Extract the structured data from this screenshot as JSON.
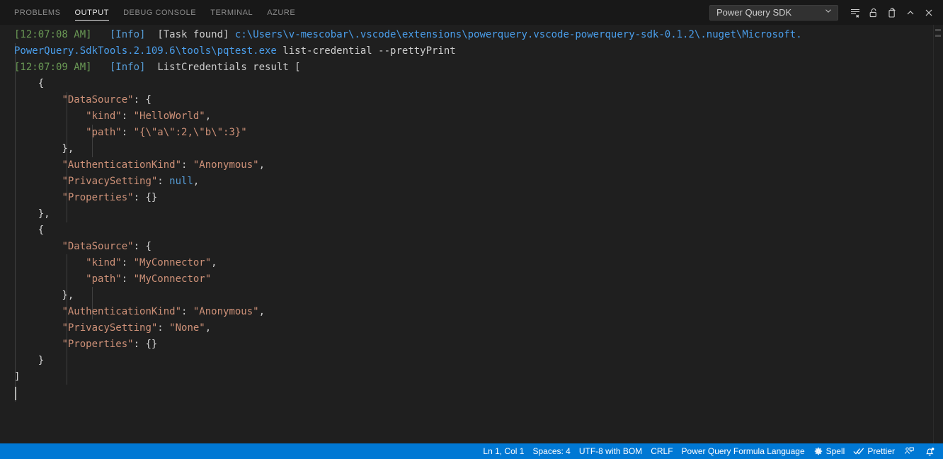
{
  "panel": {
    "tabs": [
      {
        "label": "PROBLEMS",
        "name": "tab-problems",
        "active": false
      },
      {
        "label": "OUTPUT",
        "name": "tab-output",
        "active": true
      },
      {
        "label": "DEBUG CONSOLE",
        "name": "tab-debug-console",
        "active": false
      },
      {
        "label": "TERMINAL",
        "name": "tab-terminal",
        "active": false
      },
      {
        "label": "AZURE",
        "name": "tab-azure",
        "active": false
      }
    ],
    "channel_select": {
      "value": "Power Query SDK",
      "icon": "chevron-down-icon"
    },
    "actions": [
      {
        "name": "clear-output-icon",
        "title": "Clear Output"
      },
      {
        "name": "unlock-scroll-icon",
        "title": "Turn Auto Scrolling Off"
      },
      {
        "name": "open-in-editor-icon",
        "title": "Open Output in Editor"
      },
      {
        "name": "chevron-up-icon",
        "title": "Hide Panel"
      },
      {
        "name": "close-icon",
        "title": "Close Panel"
      }
    ]
  },
  "output": {
    "lines": [
      {
        "tokens": [
          {
            "t": "[12:07:08 AM]",
            "c": "t-time"
          },
          {
            "t": "   ",
            "c": "t-plain"
          },
          {
            "t": "[Info]",
            "c": "t-info"
          },
          {
            "t": "  ",
            "c": "t-plain"
          },
          {
            "t": "[Task found]",
            "c": "t-plain"
          },
          {
            "t": " ",
            "c": "t-plain"
          },
          {
            "t": "c:\\Users\\v-mescobar\\.vscode\\extensions\\powerquery.vscode-powerquery-sdk-0.1.2\\.nuget\\Microsoft.",
            "c": "t-path"
          }
        ]
      },
      {
        "tokens": [
          {
            "t": "PowerQuery.SdkTools.2.109.6\\tools\\pqtest.exe",
            "c": "t-path"
          },
          {
            "t": " list-credential --prettyPrint",
            "c": "t-plain"
          }
        ]
      },
      {
        "tokens": [
          {
            "t": "[12:07:09 AM]",
            "c": "t-time"
          },
          {
            "t": "   ",
            "c": "t-plain"
          },
          {
            "t": "[Info]",
            "c": "t-info"
          },
          {
            "t": "  ",
            "c": "t-plain"
          },
          {
            "t": "ListCredentials result [",
            "c": "t-plain"
          }
        ]
      },
      {
        "tokens": [
          {
            "t": "    {",
            "c": "t-brace1"
          }
        ]
      },
      {
        "tokens": [
          {
            "t": "        ",
            "c": "t-plain"
          },
          {
            "t": "\"DataSource\"",
            "c": "t-key"
          },
          {
            "t": ": {",
            "c": "t-brace1"
          }
        ]
      },
      {
        "tokens": [
          {
            "t": "            ",
            "c": "t-plain"
          },
          {
            "t": "\"kind\"",
            "c": "t-key"
          },
          {
            "t": ": ",
            "c": "t-punct"
          },
          {
            "t": "\"HelloWorld\"",
            "c": "t-str"
          },
          {
            "t": ",",
            "c": "t-punct"
          }
        ]
      },
      {
        "tokens": [
          {
            "t": "            ",
            "c": "t-plain"
          },
          {
            "t": "\"path\"",
            "c": "t-key"
          },
          {
            "t": ": ",
            "c": "t-punct"
          },
          {
            "t": "\"{\\\"a\\\":2,\\\"b\\\":3}\"",
            "c": "t-str"
          }
        ]
      },
      {
        "tokens": [
          {
            "t": "        },",
            "c": "t-brace1"
          }
        ]
      },
      {
        "tokens": [
          {
            "t": "        ",
            "c": "t-plain"
          },
          {
            "t": "\"AuthenticationKind\"",
            "c": "t-key"
          },
          {
            "t": ": ",
            "c": "t-punct"
          },
          {
            "t": "\"Anonymous\"",
            "c": "t-str"
          },
          {
            "t": ",",
            "c": "t-punct"
          }
        ]
      },
      {
        "tokens": [
          {
            "t": "        ",
            "c": "t-plain"
          },
          {
            "t": "\"PrivacySetting\"",
            "c": "t-key"
          },
          {
            "t": ": ",
            "c": "t-punct"
          },
          {
            "t": "null",
            "c": "t-null"
          },
          {
            "t": ",",
            "c": "t-punct"
          }
        ]
      },
      {
        "tokens": [
          {
            "t": "        ",
            "c": "t-plain"
          },
          {
            "t": "\"Properties\"",
            "c": "t-key"
          },
          {
            "t": ": {}",
            "c": "t-brace1"
          }
        ]
      },
      {
        "tokens": [
          {
            "t": "    },",
            "c": "t-brace1"
          }
        ]
      },
      {
        "tokens": [
          {
            "t": "    {",
            "c": "t-brace1"
          }
        ]
      },
      {
        "tokens": [
          {
            "t": "        ",
            "c": "t-plain"
          },
          {
            "t": "\"DataSource\"",
            "c": "t-key"
          },
          {
            "t": ": {",
            "c": "t-brace1"
          }
        ]
      },
      {
        "tokens": [
          {
            "t": "            ",
            "c": "t-plain"
          },
          {
            "t": "\"kind\"",
            "c": "t-key"
          },
          {
            "t": ": ",
            "c": "t-punct"
          },
          {
            "t": "\"MyConnector\"",
            "c": "t-str"
          },
          {
            "t": ",",
            "c": "t-punct"
          }
        ]
      },
      {
        "tokens": [
          {
            "t": "            ",
            "c": "t-plain"
          },
          {
            "t": "\"path\"",
            "c": "t-key"
          },
          {
            "t": ": ",
            "c": "t-punct"
          },
          {
            "t": "\"MyConnector\"",
            "c": "t-str"
          }
        ]
      },
      {
        "tokens": [
          {
            "t": "        },",
            "c": "t-brace1"
          }
        ]
      },
      {
        "tokens": [
          {
            "t": "        ",
            "c": "t-plain"
          },
          {
            "t": "\"AuthenticationKind\"",
            "c": "t-key"
          },
          {
            "t": ": ",
            "c": "t-punct"
          },
          {
            "t": "\"Anonymous\"",
            "c": "t-str"
          },
          {
            "t": ",",
            "c": "t-punct"
          }
        ]
      },
      {
        "tokens": [
          {
            "t": "        ",
            "c": "t-plain"
          },
          {
            "t": "\"PrivacySetting\"",
            "c": "t-key"
          },
          {
            "t": ": ",
            "c": "t-punct"
          },
          {
            "t": "\"None\"",
            "c": "t-str"
          },
          {
            "t": ",",
            "c": "t-punct"
          }
        ]
      },
      {
        "tokens": [
          {
            "t": "        ",
            "c": "t-plain"
          },
          {
            "t": "\"Properties\"",
            "c": "t-key"
          },
          {
            "t": ": {}",
            "c": "t-brace1"
          }
        ]
      },
      {
        "tokens": [
          {
            "t": "    }",
            "c": "t-brace1"
          }
        ]
      },
      {
        "tokens": [
          {
            "t": "]",
            "c": "t-brace1"
          }
        ]
      },
      {
        "tokens": [
          {
            "t": "",
            "c": "t-plain"
          }
        ],
        "caret": true
      }
    ]
  },
  "status_bar": {
    "items": [
      {
        "name": "status-cursor-position",
        "label": "Ln 1, Col 1",
        "icon": null
      },
      {
        "name": "status-indentation",
        "label": "Spaces: 4",
        "icon": null
      },
      {
        "name": "status-encoding",
        "label": "UTF-8 with BOM",
        "icon": null
      },
      {
        "name": "status-eol",
        "label": "CRLF",
        "icon": null
      },
      {
        "name": "status-language-mode",
        "label": "Power Query Formula Language",
        "icon": null
      },
      {
        "name": "status-spell-checker",
        "label": "Spell",
        "icon": "gear-icon"
      },
      {
        "name": "status-prettier",
        "label": "Prettier",
        "icon": "double-check-icon"
      },
      {
        "name": "status-feedback",
        "label": "",
        "icon": "account-feedback-icon"
      },
      {
        "name": "status-notifications",
        "label": "",
        "icon": "bell-dot-icon"
      }
    ]
  },
  "colors": {
    "panel_bg": "#181818",
    "editor_bg": "#1f1f1f",
    "status_bar_bg": "#0078d4",
    "accent_text": "#ffffff",
    "timestamp": "#6a9955",
    "info_tag": "#569cd6",
    "path": "#4a9eeb",
    "json_key": "#ce9178",
    "json_string": "#ce9178",
    "json_null": "#569cd6"
  }
}
